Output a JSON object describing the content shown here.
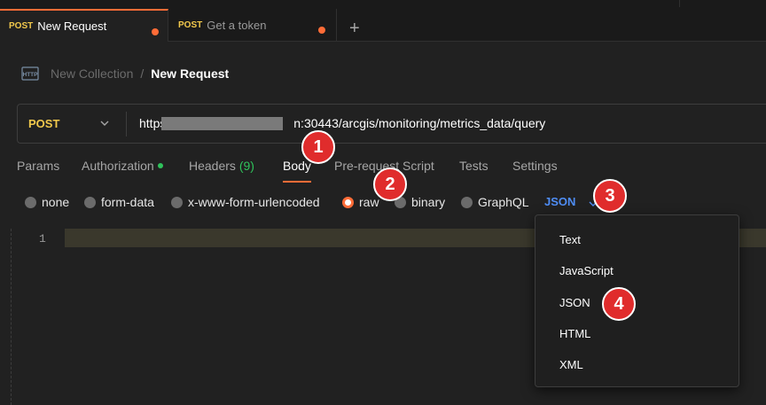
{
  "tabs": [
    {
      "method": "POST",
      "title": "New Request"
    },
    {
      "method": "POST",
      "title": "Get a token"
    }
  ],
  "tab_add_label": "+",
  "breadcrumb": {
    "collection": "New Collection",
    "separator": "/",
    "request": "New Request"
  },
  "request": {
    "method": "POST",
    "url": "https://                                  n:30443/arcgis/monitoring/metrics_data/query"
  },
  "request_tabs": {
    "params": "Params",
    "authorization": "Authorization",
    "headers": "Headers",
    "headers_count": "(9)",
    "body": "Body",
    "prerequest": "Pre-request Script",
    "tests": "Tests",
    "settings": "Settings"
  },
  "body_types": {
    "none": "none",
    "form_data": "form-data",
    "urlencoded": "x-www-form-urlencoded",
    "raw": "raw",
    "binary": "binary",
    "graphql": "GraphQL",
    "selected": "raw"
  },
  "raw_format": "JSON",
  "editor": {
    "line_number": "1"
  },
  "format_menu": [
    "Text",
    "JavaScript",
    "JSON",
    "HTML",
    "XML"
  ],
  "annotations": [
    "1",
    "2",
    "3",
    "4"
  ],
  "colors": {
    "accent": "#ff6c37",
    "method": "#f2c94c",
    "link": "#4f8df5",
    "badge": "#e02c2c",
    "ok": "#2fc25b"
  }
}
